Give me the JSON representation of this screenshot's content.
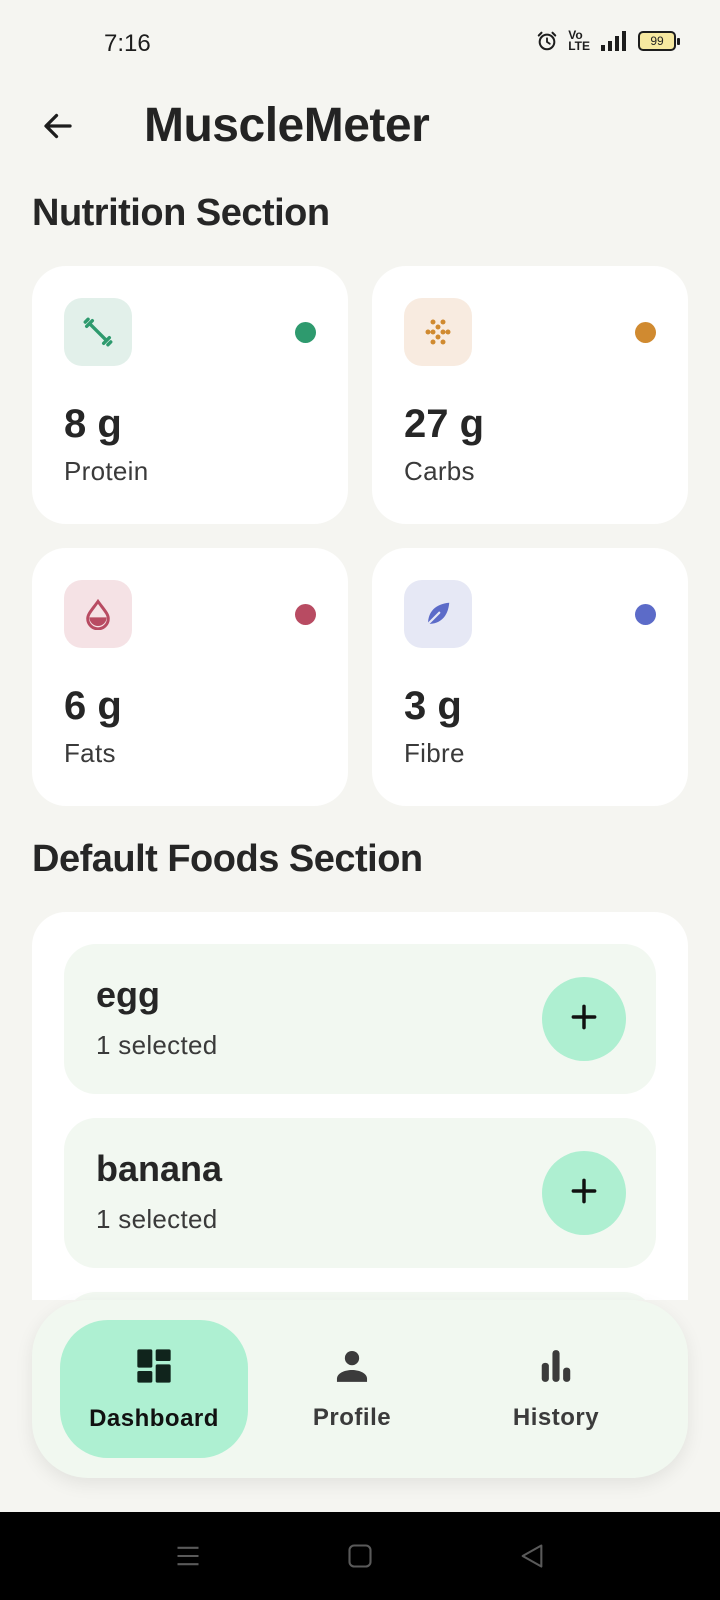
{
  "status_bar": {
    "time": "7:16",
    "volte": "Vo\nLTE",
    "battery": "99"
  },
  "header": {
    "title": "MuscleMeter"
  },
  "nutrition": {
    "title": "Nutrition Section",
    "cards": [
      {
        "value": "8 g",
        "label": "Protein",
        "icon": "dumbbell-icon",
        "accent": "#2e9a6e",
        "icon_bg": "#e2f0ea"
      },
      {
        "value": "27 g",
        "label": "Carbs",
        "icon": "grain-icon",
        "accent": "#d08a30",
        "icon_bg": "#f8ebe0"
      },
      {
        "value": "6 g",
        "label": "Fats",
        "icon": "drop-icon",
        "accent": "#b84b62",
        "icon_bg": "#f5e2e5"
      },
      {
        "value": "3 g",
        "label": "Fibre",
        "icon": "leaf-icon",
        "accent": "#5c6bc8",
        "icon_bg": "#e6e8f5"
      }
    ]
  },
  "foods": {
    "title": "Default Foods Section",
    "items": [
      {
        "name": "egg",
        "status": "1 selected"
      },
      {
        "name": "banana",
        "status": "1 selected"
      }
    ]
  },
  "bottom_nav": {
    "items": [
      {
        "label": "Dashboard",
        "icon": "dashboard-icon",
        "active": true
      },
      {
        "label": "Profile",
        "icon": "person-icon",
        "active": false
      },
      {
        "label": "History",
        "icon": "bar-chart-icon",
        "active": false
      }
    ]
  },
  "colors": {
    "background": "#f5f5f1",
    "nav_active": "#aef0d2",
    "add_button": "#aeefd1"
  }
}
